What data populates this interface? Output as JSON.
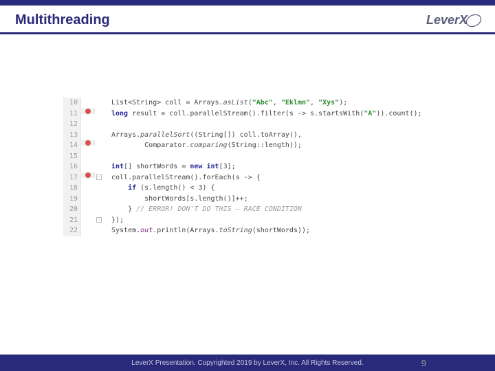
{
  "header": {
    "title": "Multithreading",
    "logo_text": "LeverX"
  },
  "code": {
    "lines": [
      {
        "n": 10,
        "bp": false,
        "fold": false,
        "tokens": [
          [
            "",
            "List<String> coll = Arrays."
          ],
          [
            "it",
            "asList"
          ],
          [
            "",
            "("
          ],
          [
            "str",
            "\"Abc\""
          ],
          [
            "",
            ", "
          ],
          [
            "str",
            "\"Eklmn\""
          ],
          [
            "",
            ", "
          ],
          [
            "str",
            "\"Xys\""
          ],
          [
            "",
            ");"
          ]
        ]
      },
      {
        "n": 11,
        "bp": true,
        "fold": false,
        "tokens": [
          [
            "kw",
            "long"
          ],
          [
            "",
            " result = coll.parallelStream().filter(s -> s.startsWith("
          ],
          [
            "str",
            "\"A\""
          ],
          [
            "",
            ")).count();"
          ]
        ]
      },
      {
        "n": 12,
        "bp": false,
        "fold": false,
        "tokens": [
          [
            "",
            ""
          ]
        ]
      },
      {
        "n": 13,
        "bp": false,
        "fold": false,
        "tokens": [
          [
            "",
            "Arrays."
          ],
          [
            "it",
            "parallelSort"
          ],
          [
            "",
            "((String[]) coll.toArray(),"
          ]
        ]
      },
      {
        "n": 14,
        "bp": true,
        "fold": false,
        "tokens": [
          [
            "",
            "        Comparator."
          ],
          [
            "it",
            "comparing"
          ],
          [
            "",
            "(String::length));"
          ]
        ]
      },
      {
        "n": 15,
        "bp": false,
        "fold": false,
        "tokens": [
          [
            "",
            ""
          ]
        ]
      },
      {
        "n": 16,
        "bp": false,
        "fold": false,
        "tokens": [
          [
            "kw",
            "int"
          ],
          [
            "",
            "[] shortWords = "
          ],
          [
            "kw",
            "new int"
          ],
          [
            "",
            "[3];"
          ]
        ]
      },
      {
        "n": 17,
        "bp": true,
        "fold": true,
        "tokens": [
          [
            "",
            "coll.parallelStream().forEach(s -> {"
          ]
        ]
      },
      {
        "n": 18,
        "bp": false,
        "fold": false,
        "tokens": [
          [
            "",
            "    "
          ],
          [
            "kw",
            "if"
          ],
          [
            "",
            " (s.length() < 3) {"
          ]
        ]
      },
      {
        "n": 19,
        "bp": false,
        "fold": false,
        "tokens": [
          [
            "",
            "        shortWords[s.length()]++;"
          ]
        ]
      },
      {
        "n": 20,
        "bp": false,
        "fold": false,
        "tokens": [
          [
            "",
            "    } "
          ],
          [
            "cm",
            "// ERROR! DON'T DO THIS – RACE CONDITION"
          ]
        ]
      },
      {
        "n": 21,
        "bp": false,
        "fold": true,
        "tokens": [
          [
            "",
            "});"
          ]
        ]
      },
      {
        "n": 22,
        "bp": false,
        "fold": false,
        "tokens": [
          [
            "",
            "System."
          ],
          [
            "field",
            "out"
          ],
          [
            "",
            ".println(Arrays."
          ],
          [
            "it",
            "toString"
          ],
          [
            "",
            "(shortWords));"
          ]
        ]
      }
    ]
  },
  "footer": {
    "copyright": "LeverX Presentation. Copyrighted 2019 by LeverX, Inc. All Rights Reserved.",
    "page": "9"
  }
}
